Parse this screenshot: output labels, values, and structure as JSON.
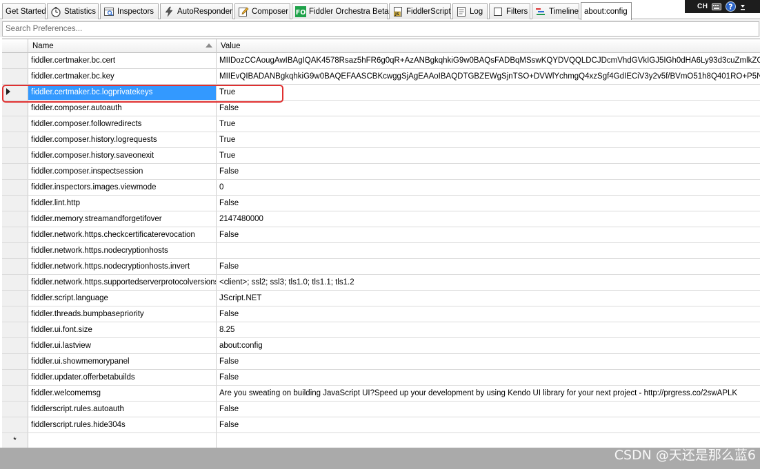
{
  "tabs": [
    {
      "id": "get-started",
      "label": "Get Started",
      "icon": "none"
    },
    {
      "id": "statistics",
      "label": "Statistics",
      "icon": "stopwatch-icon"
    },
    {
      "id": "inspectors",
      "label": "Inspectors",
      "icon": "inspectors-icon"
    },
    {
      "id": "autoresponder",
      "label": "AutoResponder",
      "icon": "lightning-icon"
    },
    {
      "id": "composer",
      "label": "Composer",
      "icon": "composer-pencil-icon"
    },
    {
      "id": "fiddler-orchestra",
      "label": "Fiddler Orchestra Beta",
      "icon": "fo-icon",
      "icon_text": "FO"
    },
    {
      "id": "fiddlerscript",
      "label": "FiddlerScript",
      "icon": "script-icon",
      "icon_text": "JS"
    },
    {
      "id": "log",
      "label": "Log",
      "icon": "log-icon"
    },
    {
      "id": "filters",
      "label": "Filters",
      "icon": "checkbox-icon"
    },
    {
      "id": "timeline",
      "label": "Timeline",
      "icon": "timeline-icon"
    },
    {
      "id": "about-config",
      "label": "about:config",
      "icon": "none",
      "active": true
    }
  ],
  "tray": {
    "lang": "CH"
  },
  "search": {
    "placeholder": "Search Preferences..."
  },
  "grid": {
    "columns": {
      "name": "Name",
      "value": "Value"
    },
    "sort": "name-ascending",
    "selected_index": 2,
    "rows": [
      {
        "name": "fiddler.certmaker.bc.cert",
        "value": "MIIDozCCAougAwIBAgIQAK4578Rsaz5hFR6g0qR+AzANBgkqhkiG9w0BAQsFADBqMSswKQYDVQQLDCJDcmVhdGVkIGJ5IGh0dHA6Ly93d3cuZmlkZGxlcjIuY29tMRgwF"
      },
      {
        "name": "fiddler.certmaker.bc.key",
        "value": "MIIEvQIBADANBgkqhkiG9w0BAQEFAASCBKcwggSjAgEAAoIBAQDTGBZEWgSjnTSO+DVWlYchmgQ4xzSgf4GdIECiV3y2v5f/BVmO51h8Q401RO+P5NZh0RkhwDUPDNM"
      },
      {
        "name": "fiddler.certmaker.bc.logprivatekeys",
        "value": "True"
      },
      {
        "name": "fiddler.composer.autoauth",
        "value": "False"
      },
      {
        "name": "fiddler.composer.followredirects",
        "value": "True"
      },
      {
        "name": "fiddler.composer.history.logrequests",
        "value": "True"
      },
      {
        "name": "fiddler.composer.history.saveonexit",
        "value": "True"
      },
      {
        "name": "fiddler.composer.inspectsession",
        "value": "False"
      },
      {
        "name": "fiddler.inspectors.images.viewmode",
        "value": "0"
      },
      {
        "name": "fiddler.lint.http",
        "value": "False"
      },
      {
        "name": "fiddler.memory.streamandforgetifover",
        "value": "2147480000"
      },
      {
        "name": "fiddler.network.https.checkcertificaterevocation",
        "value": "False"
      },
      {
        "name": "fiddler.network.https.nodecryptionhosts",
        "value": ""
      },
      {
        "name": "fiddler.network.https.nodecryptionhosts.invert",
        "value": "False"
      },
      {
        "name": "fiddler.network.https.supportedserverprotocolversions",
        "value": " <client>; ssl2; ssl3; tls1.0; tls1.1; tls1.2"
      },
      {
        "name": "fiddler.script.language",
        "value": "JScript.NET"
      },
      {
        "name": "fiddler.threads.bumpbasepriority",
        "value": "False"
      },
      {
        "name": "fiddler.ui.font.size",
        "value": "8.25"
      },
      {
        "name": "fiddler.ui.lastview",
        "value": "about:config"
      },
      {
        "name": "fiddler.ui.showmemorypanel",
        "value": "False"
      },
      {
        "name": "fiddler.updater.offerbetabuilds",
        "value": "False"
      },
      {
        "name": "fiddler.welcomemsg",
        "value": "Are you sweating on building JavaScript UI?Speed up your development by using Kendo UI library for your next project - http://prgress.co/2swAPLK"
      },
      {
        "name": "fiddlerscript.rules.autoauth",
        "value": "False"
      },
      {
        "name": "fiddlerscript.rules.hide304s",
        "value": "False"
      }
    ],
    "new_row_marker": "*"
  },
  "colors": {
    "selection": "#3399ff",
    "highlight_box": "#e03030",
    "fo_green": "#1fa24a"
  },
  "watermark": "CSDN @天还是那么蓝6"
}
